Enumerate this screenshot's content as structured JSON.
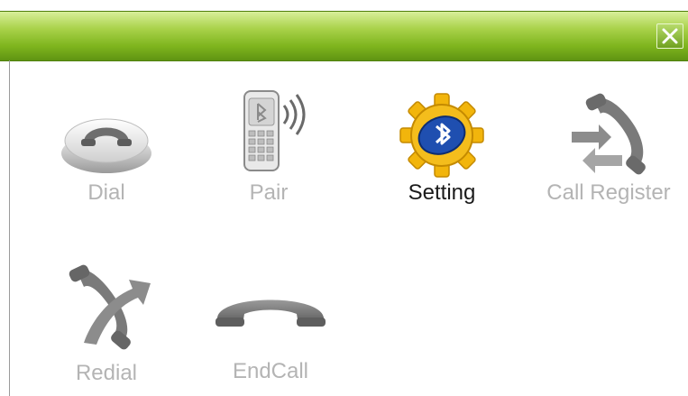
{
  "window": {
    "close_icon": "close-x-icon"
  },
  "menu": {
    "items": [
      {
        "label": "Dial",
        "icon": "handset-button-icon",
        "active": false
      },
      {
        "label": "Pair",
        "icon": "bluetooth-phone-icon",
        "active": false
      },
      {
        "label": "Setting",
        "icon": "bluetooth-gear-icon",
        "active": true
      },
      {
        "label": "Call Register",
        "icon": "call-register-icon",
        "active": false
      },
      {
        "label": "Redial",
        "icon": "redial-icon",
        "active": false
      },
      {
        "label": "EndCall",
        "icon": "end-call-icon",
        "active": false
      }
    ]
  },
  "colors": {
    "titlebar": "#7fb51e",
    "label_inactive": "#b4b4b4",
    "label_active": "#1a1a1a",
    "gear": "#f2b50c",
    "bluetooth_badge": "#1f4fb0"
  }
}
